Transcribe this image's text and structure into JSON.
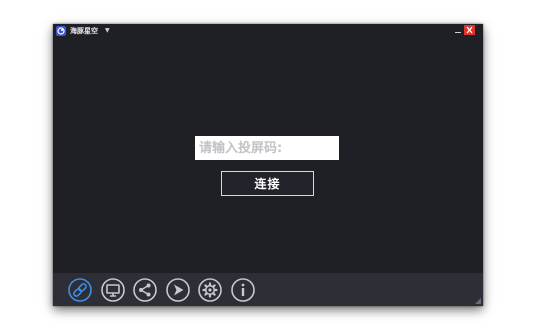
{
  "window": {
    "title": "海豚星空",
    "dropdown_glyph": "▼"
  },
  "main": {
    "code_placeholder": "请输入投屏码:",
    "code_value": "",
    "connect_label": "连接"
  },
  "toolbar": {
    "buttons": [
      {
        "icon": "link-icon",
        "state": "active"
      },
      {
        "icon": "monitor-icon",
        "state": "normal"
      },
      {
        "icon": "share-icon",
        "state": "normal"
      },
      {
        "icon": "send-icon",
        "state": "normal"
      },
      {
        "icon": "gear-icon",
        "state": "normal"
      },
      {
        "icon": "info-icon",
        "state": "normal"
      }
    ]
  },
  "colors": {
    "background": "#1f2025",
    "toolbar": "#2d2e36",
    "active_icon": "#3d8ee8",
    "icon": "#c8c9cd",
    "close_button": "#e0342b"
  }
}
